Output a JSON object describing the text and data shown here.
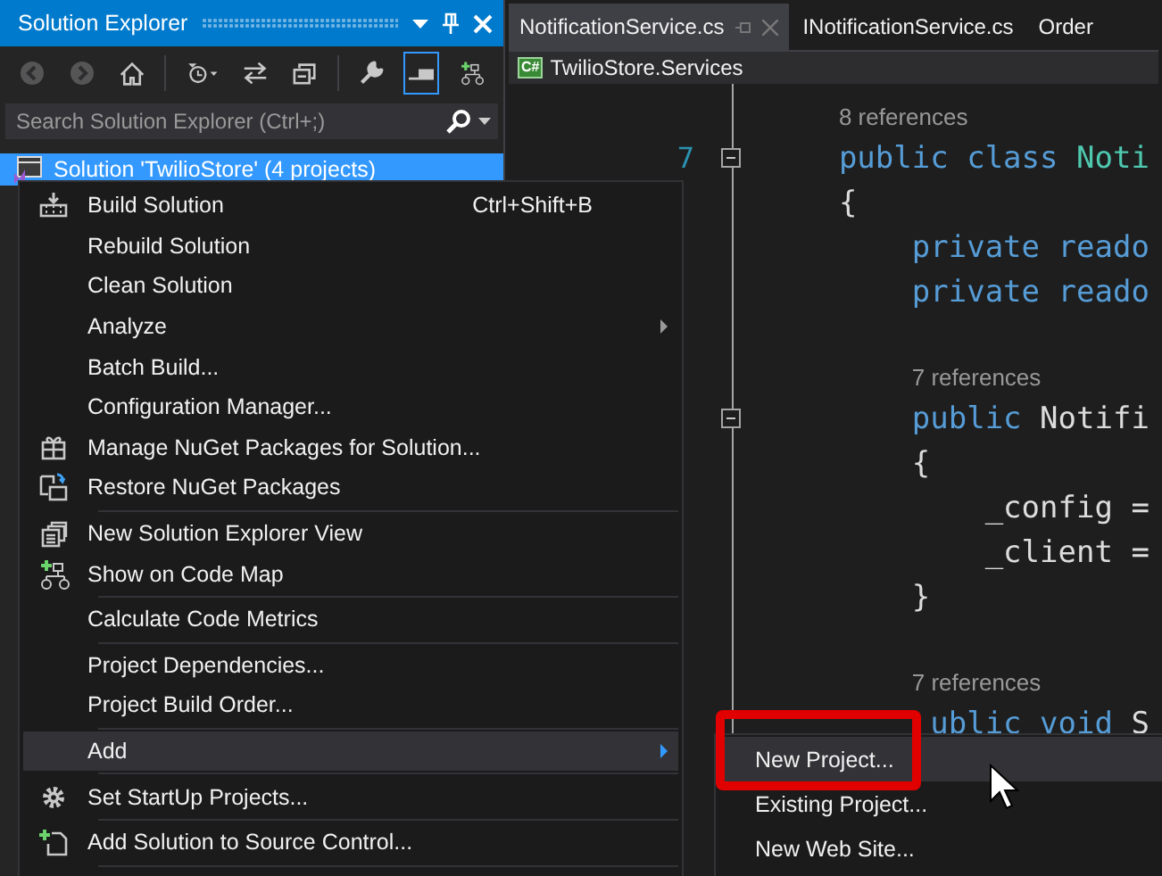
{
  "explorer": {
    "title": "Solution Explorer",
    "toolbar": [
      {
        "disabled": true,
        "selected": false
      },
      {
        "disabled": true,
        "selected": false
      },
      {
        "disabled": false,
        "selected": false
      },
      {
        "disabled": false,
        "selected": false
      },
      {
        "disabled": false,
        "selected": false
      },
      {
        "disabled": false,
        "selected": false
      },
      {
        "disabled": false,
        "selected": false
      },
      {
        "disabled": false,
        "selected": true
      },
      {
        "disabled": false,
        "selected": false
      }
    ],
    "search": {
      "placeholder": "Search Solution Explorer (Ctrl+;)"
    },
    "tree": [
      {
        "label": "Solution 'TwilioStore' (4 projects)",
        "selected": true
      }
    ]
  },
  "editor": {
    "tabs": [
      {
        "label": "NotificationService.cs",
        "selected": true
      },
      {
        "label": "INotificationService.cs",
        "selected": false
      },
      {
        "label": "Order",
        "selected": false
      }
    ],
    "breadcrumb": {
      "badge": "C#",
      "label": "TwilioStore.Services"
    },
    "lines": [
      {
        "kind": "codelens",
        "text": "    8 references"
      },
      {
        "kind": "code",
        "number": "7",
        "fold": true,
        "tokens": [
          {
            "t": "    public class ",
            "kind": "keyword"
          },
          {
            "t": "Noti",
            "kind": "class"
          }
        ]
      },
      {
        "kind": "code",
        "tokens": [
          {
            "t": "    {",
            "kind": "plain"
          }
        ]
      },
      {
        "kind": "code",
        "tokens": [
          {
            "t": "        private reado",
            "kind": "keyword"
          }
        ]
      },
      {
        "kind": "code",
        "tokens": [
          {
            "t": "        private reado",
            "kind": "keyword"
          }
        ]
      },
      {
        "kind": "blank"
      },
      {
        "kind": "codelens",
        "text": "        7 references"
      },
      {
        "kind": "code",
        "fold": true,
        "tokens": [
          {
            "t": "        public ",
            "kind": "keyword"
          },
          {
            "t": "Notifi",
            "kind": "plain"
          }
        ]
      },
      {
        "kind": "code",
        "tokens": [
          {
            "t": "        {",
            "kind": "plain"
          }
        ]
      },
      {
        "kind": "code",
        "tokens": [
          {
            "t": "            _config =",
            "kind": "plain"
          }
        ]
      },
      {
        "kind": "code",
        "tokens": [
          {
            "t": "            _client =",
            "kind": "plain"
          }
        ]
      },
      {
        "kind": "code",
        "tokens": [
          {
            "t": "        }",
            "kind": "plain"
          }
        ]
      },
      {
        "kind": "blank"
      },
      {
        "kind": "codelens",
        "text": "        7 references"
      },
      {
        "kind": "code",
        "tokens": [
          {
            "t": "         ublic void ",
            "kind": "keyword"
          },
          {
            "t": "S",
            "kind": "plain"
          }
        ]
      }
    ]
  },
  "context_menu": {
    "items": [
      {
        "kind": "item",
        "label": "Build Solution",
        "shortcut": "Ctrl+Shift+B",
        "submenu": false,
        "selected": false
      },
      {
        "kind": "item",
        "label": "Rebuild Solution",
        "submenu": false,
        "selected": false
      },
      {
        "kind": "item",
        "label": "Clean Solution",
        "submenu": false,
        "selected": false
      },
      {
        "kind": "item",
        "label": "Analyze",
        "submenu": true,
        "selected": false
      },
      {
        "kind": "item",
        "label": "Batch Build...",
        "submenu": false,
        "selected": false
      },
      {
        "kind": "item",
        "label": "Configuration Manager...",
        "submenu": false,
        "selected": false
      },
      {
        "kind": "item",
        "label": "Manage NuGet Packages for Solution...",
        "submenu": false,
        "selected": false
      },
      {
        "kind": "item",
        "label": "Restore NuGet Packages",
        "submenu": false,
        "selected": false
      },
      {
        "kind": "separator"
      },
      {
        "kind": "item",
        "label": "New Solution Explorer View",
        "submenu": false,
        "selected": false
      },
      {
        "kind": "item",
        "label": "Show on Code Map",
        "submenu": false,
        "selected": false
      },
      {
        "kind": "separator"
      },
      {
        "kind": "item",
        "label": "Calculate Code Metrics",
        "submenu": false,
        "selected": false
      },
      {
        "kind": "separator"
      },
      {
        "kind": "item",
        "label": "Project Dependencies...",
        "submenu": false,
        "selected": false
      },
      {
        "kind": "item",
        "label": "Project Build Order...",
        "submenu": false,
        "selected": false
      },
      {
        "kind": "separator"
      },
      {
        "kind": "item",
        "label": "Add",
        "submenu": true,
        "selected": true
      },
      {
        "kind": "separator"
      },
      {
        "kind": "item",
        "label": "Set StartUp Projects...",
        "submenu": false,
        "selected": false
      },
      {
        "kind": "separator"
      },
      {
        "kind": "item",
        "label": "Add Solution to Source Control...",
        "submenu": false,
        "selected": false
      },
      {
        "kind": "separator"
      }
    ]
  },
  "submenu": {
    "items": [
      {
        "label": "New Project...",
        "selected": true
      },
      {
        "label": "Existing Project...",
        "selected": false
      },
      {
        "label": "New Web Site...",
        "selected": false
      }
    ]
  }
}
